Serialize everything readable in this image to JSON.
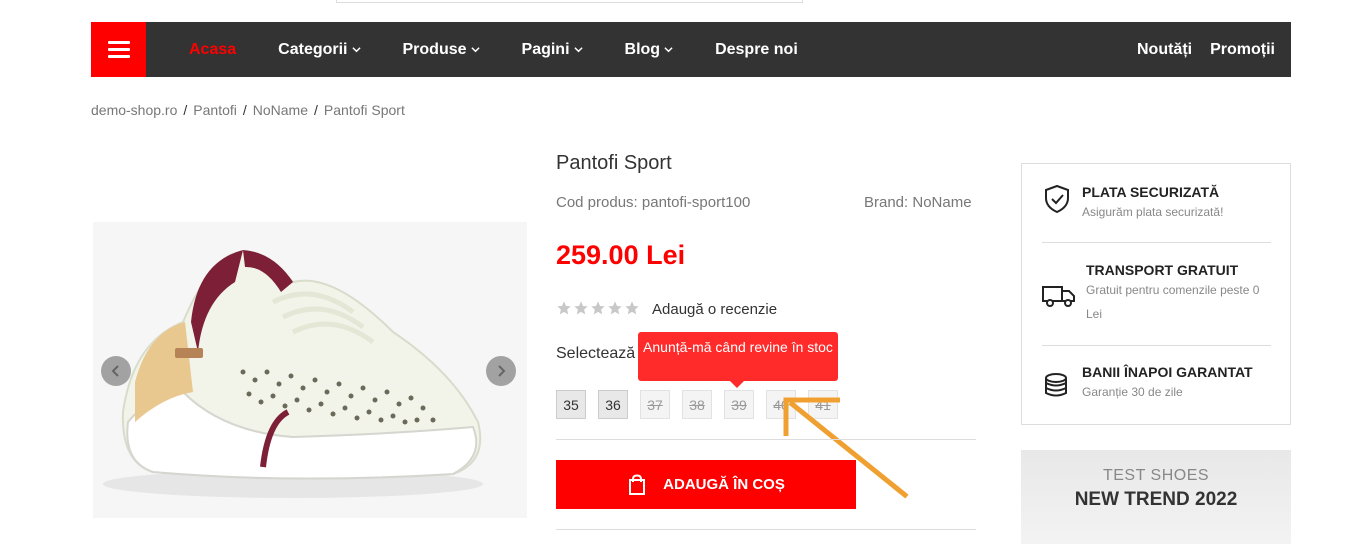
{
  "nav": {
    "menu_icon": "hamburger-icon",
    "items": [
      {
        "label": "Acasa",
        "active": true,
        "dropdown": false
      },
      {
        "label": "Categorii",
        "dropdown": true
      },
      {
        "label": "Produse",
        "dropdown": true
      },
      {
        "label": "Pagini",
        "dropdown": true
      },
      {
        "label": "Blog",
        "dropdown": true
      },
      {
        "label": "Despre noi",
        "dropdown": false
      }
    ],
    "right": [
      "Noutăți",
      "Promoții"
    ]
  },
  "breadcrumb": [
    "demo-shop.ro",
    "Pantofi",
    "NoName",
    "Pantofi Sport"
  ],
  "product": {
    "title": "Pantofi Sport",
    "code": "Cod produs: pantofi-sport100",
    "brand": "Brand: NoName",
    "price": "259.00 Lei",
    "rating": 0,
    "review_link": "Adaugă o recenzie",
    "select_label": "Selectează o mărime",
    "sizes": [
      {
        "label": "35",
        "available": true
      },
      {
        "label": "36",
        "available": true
      },
      {
        "label": "37",
        "available": false
      },
      {
        "label": "38",
        "available": false
      },
      {
        "label": "39",
        "available": false
      },
      {
        "label": "40",
        "available": false
      },
      {
        "label": "41",
        "available": false
      }
    ],
    "tooltip": "Anunță-mă când revine în stoc",
    "add_to_cart": "ADAUGĂ ÎN COȘ"
  },
  "info": [
    {
      "icon": "shield-check-icon",
      "title": "PLATA SECURIZATĂ",
      "sub": "Asigurăm plata securizată!"
    },
    {
      "icon": "truck-icon",
      "title": "TRANSPORT GRATUIT",
      "sub": "Gratuit pentru comenzile peste 0 Lei"
    },
    {
      "icon": "coins-icon",
      "title": "BANII ÎNAPOI GARANTAT",
      "sub": "Garanție 30 de zile"
    }
  ],
  "banner": {
    "line1": "TEST SHOES",
    "line2": "NEW TREND 2022"
  },
  "colors": {
    "accent": "#ff0000",
    "nav_bg": "#333333",
    "annotation": "#f0a030"
  }
}
